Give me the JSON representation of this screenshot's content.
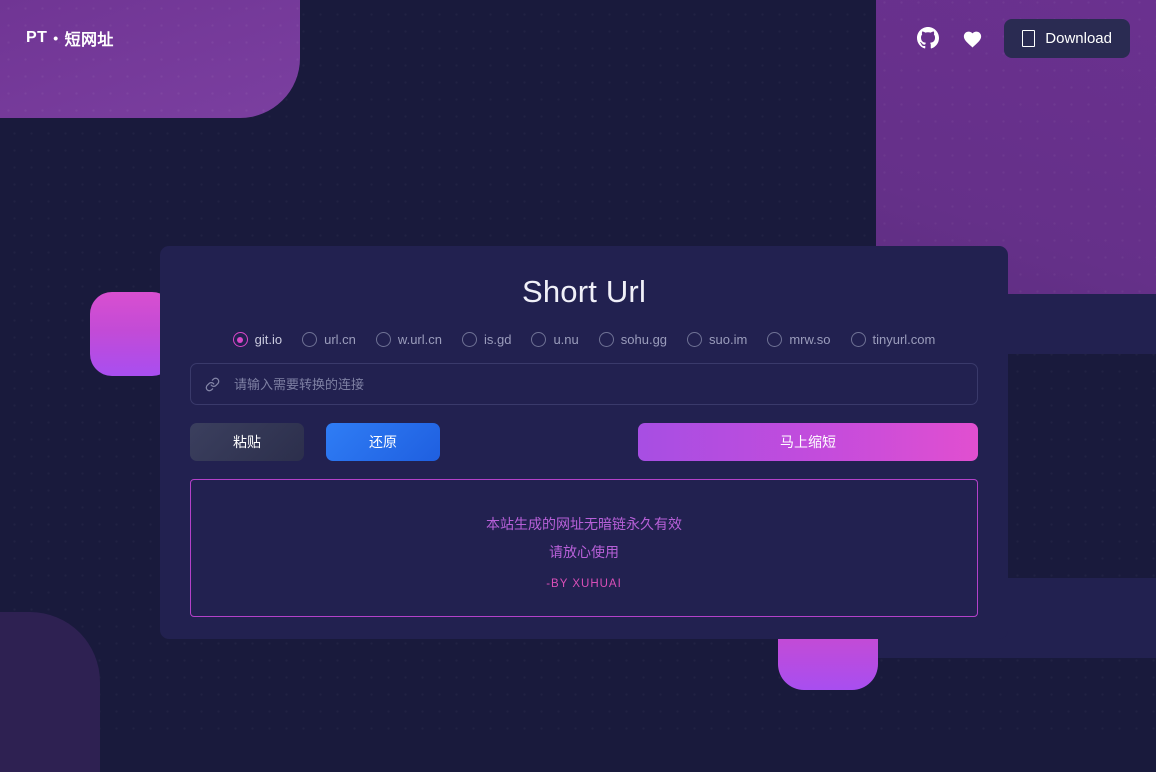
{
  "header": {
    "brand_prefix": "PT",
    "brand_separator": "•",
    "brand_name": "短网址",
    "github_icon": "github-icon",
    "heart_icon": "heart-icon",
    "download_label": "Download",
    "download_glyph": "missing-glyph-box"
  },
  "card": {
    "title": "Short Url",
    "providers": [
      {
        "label": "git.io",
        "selected": true
      },
      {
        "label": "url.cn",
        "selected": false
      },
      {
        "label": "w.url.cn",
        "selected": false
      },
      {
        "label": "is.gd",
        "selected": false
      },
      {
        "label": "u.nu",
        "selected": false
      },
      {
        "label": "sohu.gg",
        "selected": false
      },
      {
        "label": "suo.im",
        "selected": false
      },
      {
        "label": "mrw.so",
        "selected": false
      },
      {
        "label": "tinyurl.com",
        "selected": false
      }
    ],
    "input": {
      "icon": "link-icon",
      "value": "",
      "placeholder": "请输入需要转换的连接"
    },
    "buttons": {
      "paste": "粘贴",
      "restore": "还原",
      "shorten": "马上缩短"
    },
    "notice": {
      "line1": "本站生成的网址无暗链永久有效",
      "line2": "请放心使用",
      "author": "-BY XUHUAI"
    }
  },
  "colors": {
    "background": "#191a3c",
    "card": "#222150",
    "brand_purple": "#7b3fa0",
    "accent_magenta": "#d946c8",
    "accent_blue": "#2f7df5",
    "notice_border": "#b341c9"
  }
}
